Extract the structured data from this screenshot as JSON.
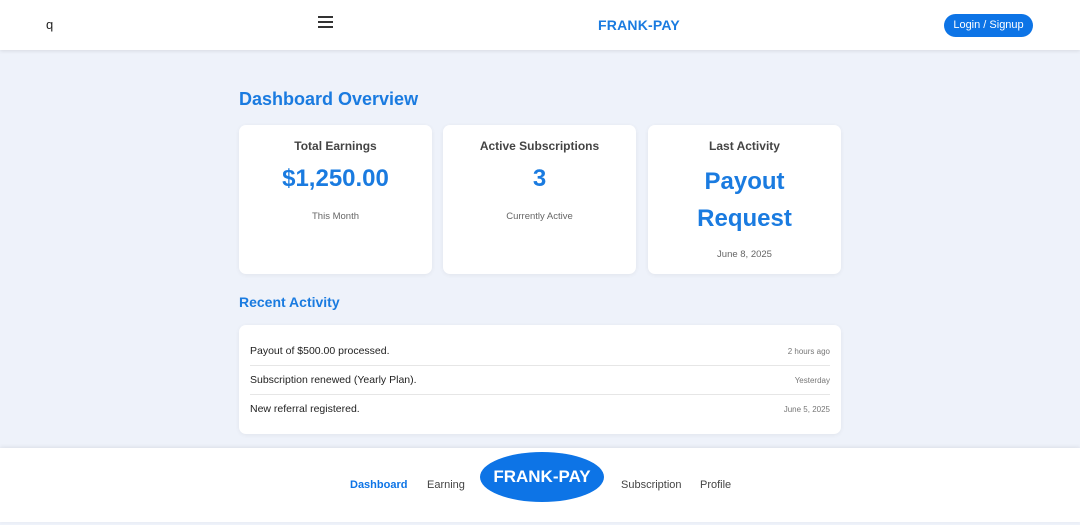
{
  "header": {
    "search_key": "q",
    "menu_icon": "hamburger-menu-icon",
    "brand": "FRANK-PAY",
    "login_label": "Login / Signup"
  },
  "colors": {
    "accent": "#1a7be0",
    "button": "#0d74e6",
    "background": "#eef2fa",
    "card": "#ffffff"
  },
  "dashboard": {
    "title": "Dashboard Overview",
    "cards": [
      {
        "label": "Total Earnings",
        "value": "$1,250.00",
        "sub": "This Month"
      },
      {
        "label": "Active Subscriptions",
        "value": "3",
        "sub": "Currently Active"
      },
      {
        "label": "Last Activity",
        "value": "Payout Request",
        "sub": "June 8, 2025"
      }
    ]
  },
  "recent": {
    "title": "Recent Activity",
    "items": [
      {
        "text": "Payout of $500.00 processed.",
        "time": "2 hours ago"
      },
      {
        "text": "Subscription renewed (Yearly Plan).",
        "time": "Yesterday"
      },
      {
        "text": "New referral registered.",
        "time": "June 5, 2025"
      }
    ]
  },
  "bottom_nav": {
    "items": [
      "Dashboard",
      "Earning",
      "Subscription",
      "Profile"
    ],
    "active": "Dashboard",
    "center_label": "FRANK-PAY"
  }
}
